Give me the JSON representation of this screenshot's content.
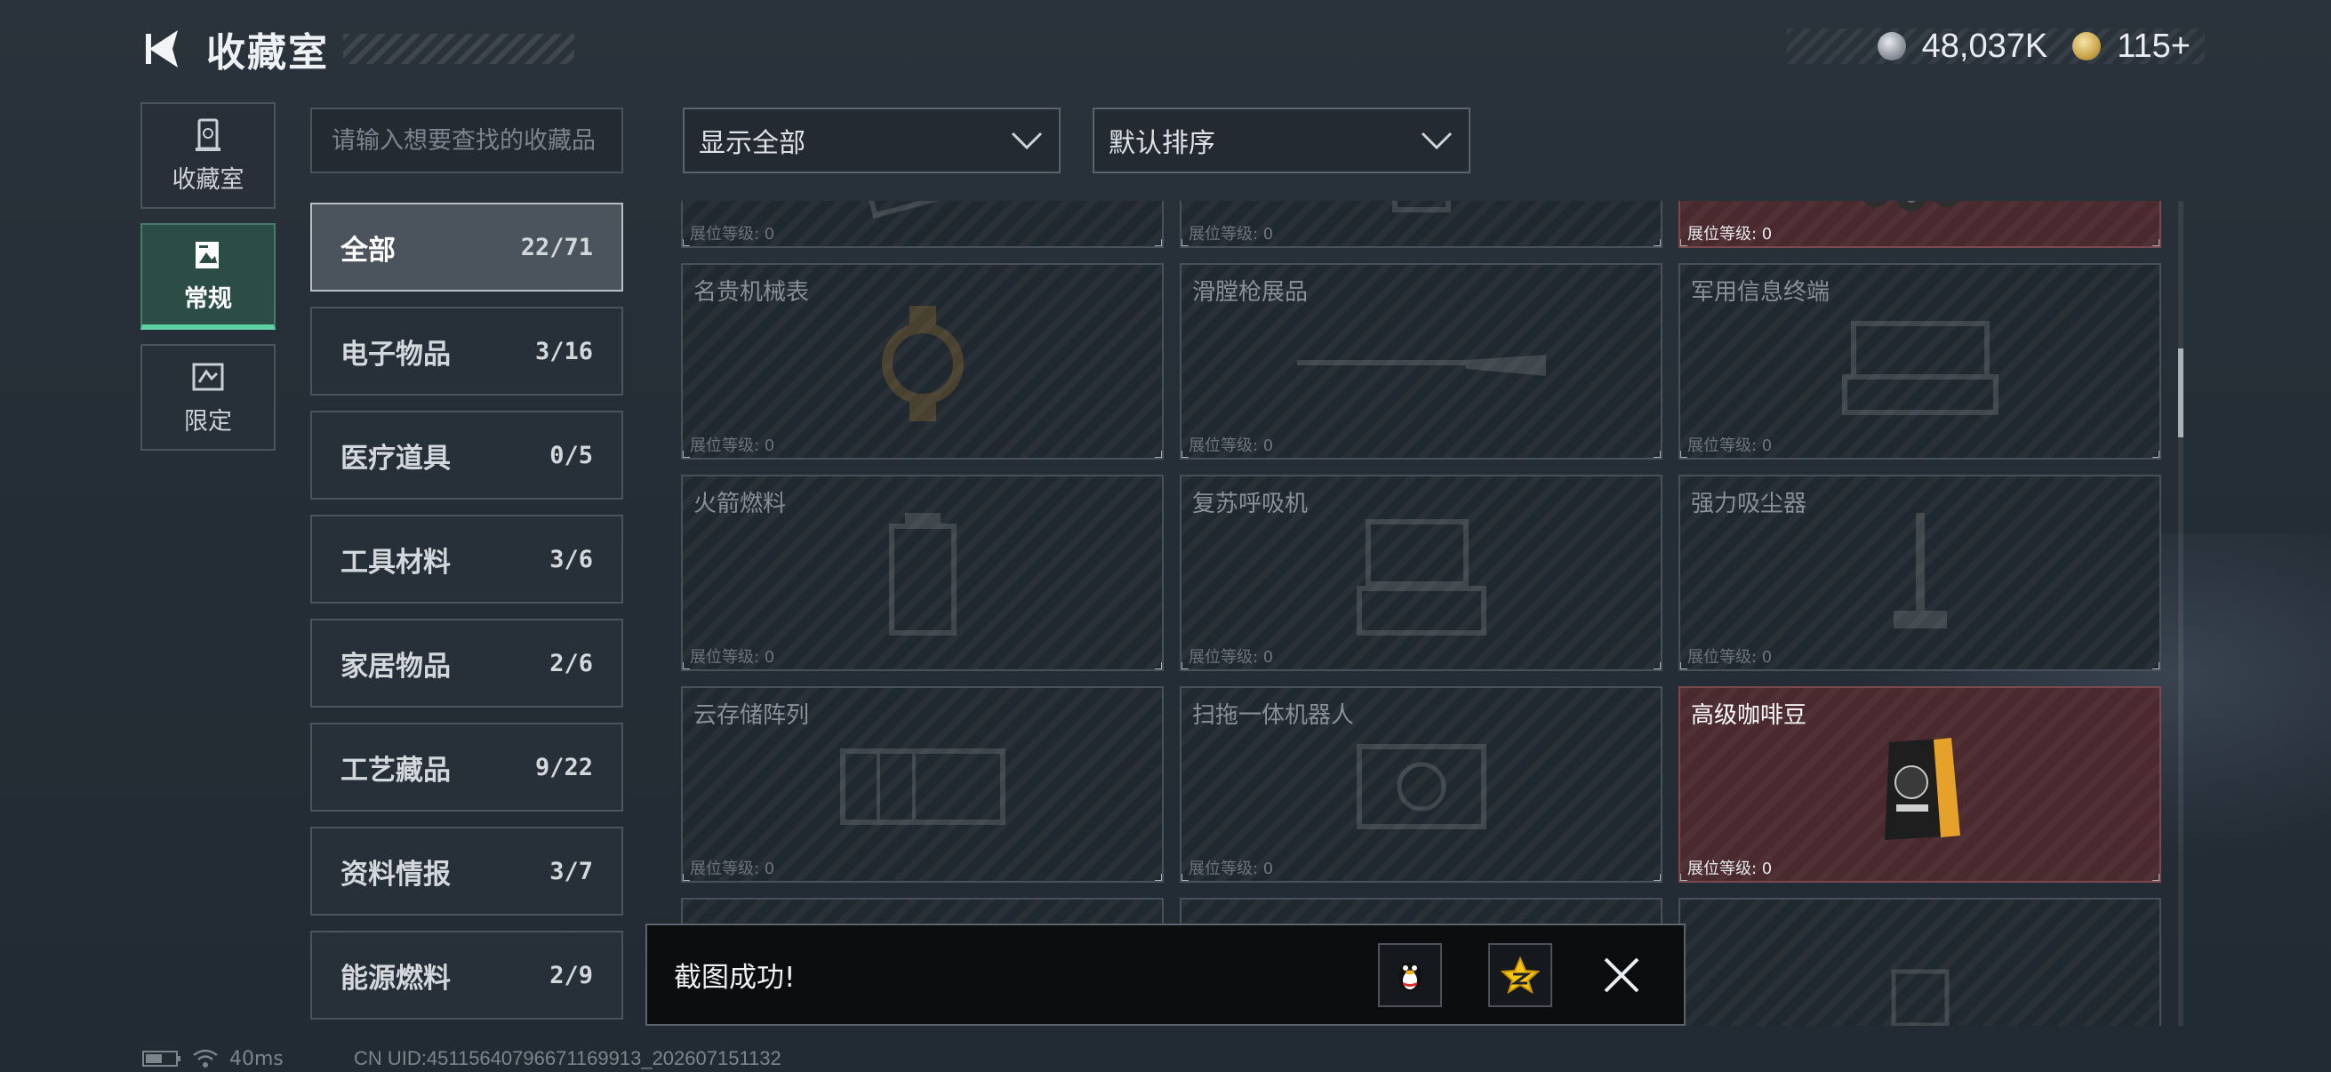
{
  "header": {
    "title": "收藏室",
    "currency": [
      {
        "icon": "silver-coin-icon",
        "amount": "48,037K"
      },
      {
        "icon": "gold-coin-icon",
        "amount": "115+"
      }
    ]
  },
  "vnav": {
    "items": [
      {
        "label": "收藏室",
        "icon": "collection-room-icon",
        "active": false
      },
      {
        "label": "常规",
        "icon": "regular-gallery-icon",
        "active": true
      },
      {
        "label": "限定",
        "icon": "limited-icon",
        "active": false
      }
    ]
  },
  "search": {
    "placeholder": "请输入想要查找的收藏品"
  },
  "categories": [
    {
      "name": "全部",
      "count": "22/71",
      "active": true
    },
    {
      "name": "电子物品",
      "count": "3/16"
    },
    {
      "name": "医疗道具",
      "count": "0/5"
    },
    {
      "name": "工具材料",
      "count": "3/6"
    },
    {
      "name": "家居物品",
      "count": "2/6"
    },
    {
      "name": "工艺藏品",
      "count": "9/22"
    },
    {
      "name": "资料情报",
      "count": "3/7"
    },
    {
      "name": "能源燃料",
      "count": "2/9"
    }
  ],
  "filters": {
    "show": "显示全部",
    "sort": "默认排序"
  },
  "level_label": "展位等级: 0",
  "items": [
    {
      "name": "",
      "owned": false,
      "icon": "circuit-board-icon"
    },
    {
      "name": "",
      "owned": false,
      "icon": "device-icon"
    },
    {
      "name": "",
      "owned": true,
      "icon": "armored-vehicle-icon"
    },
    {
      "name": "名贵机械表",
      "owned": false,
      "icon": "watch-icon"
    },
    {
      "name": "滑膛枪展品",
      "owned": false,
      "icon": "musket-icon"
    },
    {
      "name": "军用信息终端",
      "owned": false,
      "icon": "military-terminal-icon"
    },
    {
      "name": "火箭燃料",
      "owned": false,
      "icon": "rocket-fuel-icon"
    },
    {
      "name": "复苏呼吸机",
      "owned": false,
      "icon": "ventilator-icon"
    },
    {
      "name": "强力吸尘器",
      "owned": false,
      "icon": "vacuum-icon"
    },
    {
      "name": "云存储阵列",
      "owned": false,
      "icon": "storage-array-icon"
    },
    {
      "name": "扫拖一体机器人",
      "owned": false,
      "icon": "robot-vacuum-icon"
    },
    {
      "name": "高级咖啡豆",
      "owned": true,
      "icon": "coffee-bag-icon"
    },
    {
      "name": "",
      "owned": false,
      "icon": "item-icon"
    },
    {
      "name": "",
      "owned": false,
      "icon": "item-icon"
    },
    {
      "name": "",
      "owned": false,
      "icon": "item-icon"
    }
  ],
  "toast": {
    "message": "截图成功!",
    "share_qq_icon": "qq-penguin-icon",
    "share_qzone_icon": "qzone-star-icon"
  },
  "status": {
    "ping": "40ms",
    "uid": "CN UID:45115640796671169913_202607151132"
  },
  "colors": {
    "accent_green": "#5fd0a2",
    "owned_card": "#4a2a2f"
  }
}
